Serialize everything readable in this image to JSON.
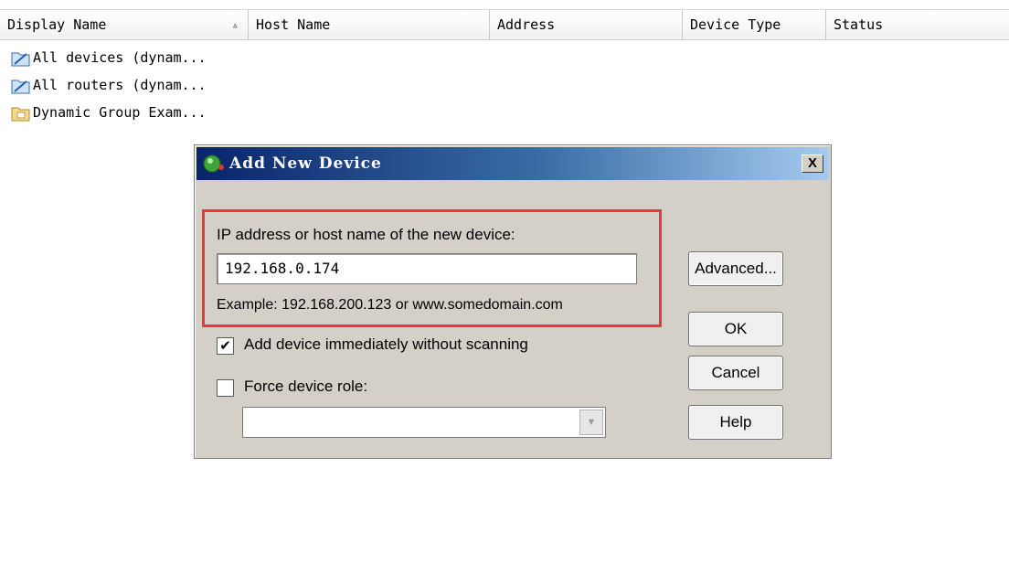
{
  "list": {
    "columns": {
      "display_name": "Display Name",
      "host_name": "Host Name",
      "address": "Address",
      "device_type": "Device Type",
      "status": "Status"
    },
    "sort_indicator": "▵",
    "rows": [
      {
        "label": "All devices (dynam...",
        "icon": "dynamic-group-folder-icon"
      },
      {
        "label": "All routers (dynam...",
        "icon": "dynamic-group-folder-icon"
      },
      {
        "label": "Dynamic Group Exam...",
        "icon": "group-folder-icon"
      }
    ]
  },
  "dialog": {
    "title": "Add New Device",
    "close_label": "X",
    "ip_label": "IP address or host name of the new device:",
    "ip_value": "192.168.0.174",
    "example_text": "Example: 192.168.200.123 or www.somedomain.com",
    "add_immediately_label": "Add device immediately without scanning",
    "add_immediately_checked": true,
    "force_role_label": "Force device role:",
    "force_role_checked": false,
    "force_role_value": "",
    "buttons": {
      "advanced": "Advanced...",
      "ok": "OK",
      "cancel": "Cancel",
      "help": "Help"
    },
    "highlight_color": "#e8383d",
    "title_gradient": [
      "#0a246a",
      "#a6caf0"
    ]
  }
}
